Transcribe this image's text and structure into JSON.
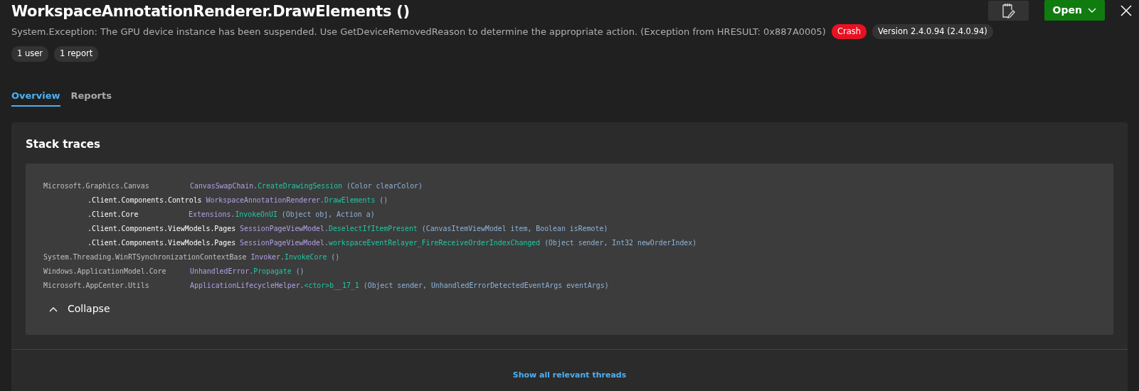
{
  "header": {
    "title": "WorkspaceAnnotationRenderer.DrawElements ()",
    "message": "System.Exception: The GPU device instance has been suspended. Use GetDeviceRemovedReason to determine the appropriate action. (Exception from HRESULT: 0x887A0005)",
    "badges": [
      {
        "text": "Crash",
        "kind": "danger"
      },
      {
        "text": "Version 2.4.0.94 (2.4.0.94)",
        "kind": "plain"
      },
      {
        "text": "1 user",
        "kind": "plain"
      },
      {
        "text": "1 report",
        "kind": "plain"
      }
    ],
    "open_button": "Open"
  },
  "tabs": [
    {
      "label": "Overview",
      "selected": true
    },
    {
      "label": "Reports",
      "selected": false
    }
  ],
  "stack": {
    "title": "Stack traces",
    "frames": [
      {
        "namespace": "Microsoft.Graphics.Canvas",
        "own": false,
        "class": "CanvasSwapChain.",
        "method": "CreateDrawingSession",
        "args": "(Color clearColor)"
      },
      {
        "namespace": ".Client.Components.Controls",
        "own": true,
        "class": "WorkspaceAnnotationRenderer.",
        "method": "DrawElements",
        "args": "()"
      },
      {
        "namespace": ".Client.Core",
        "own": true,
        "class": "Extensions.",
        "method": "InvokeOnUI",
        "args": "(Object obj, Action a)"
      },
      {
        "namespace": ".Client.Components.ViewModels.Pages",
        "own": true,
        "class": "SessionPageViewModel.",
        "method": "DeselectIfItemPresent",
        "args": "(CanvasItemViewModel item, Boolean isRemote)"
      },
      {
        "namespace": ".Client.Components.ViewModels.Pages",
        "own": true,
        "class": "SessionPageViewModel.",
        "method": "workspaceEventRelayer_FireReceiveOrderIndexChanged",
        "args": "(Object sender, Int32 newOrderIndex)"
      },
      {
        "namespace": "System.Threading.WinRTSynchronizationContextBase",
        "own": false,
        "class": "Invoker.",
        "method": "InvokeCore",
        "args": "()"
      },
      {
        "namespace": "Windows.ApplicationModel.Core",
        "own": false,
        "class": "UnhandledError.",
        "method": "Propagate",
        "args": "()"
      },
      {
        "namespace": "Microsoft.AppCenter.Utils",
        "own": false,
        "class": "ApplicationLifecycleHelper.",
        "method": "<ctor>b__17_1",
        "args": "(Object sender, UnhandledErrorDetectedEventArgs eventArgs)"
      }
    ],
    "collapse": "Collapse",
    "expanded": true
  },
  "footer_link": "Show all relevant threads"
}
